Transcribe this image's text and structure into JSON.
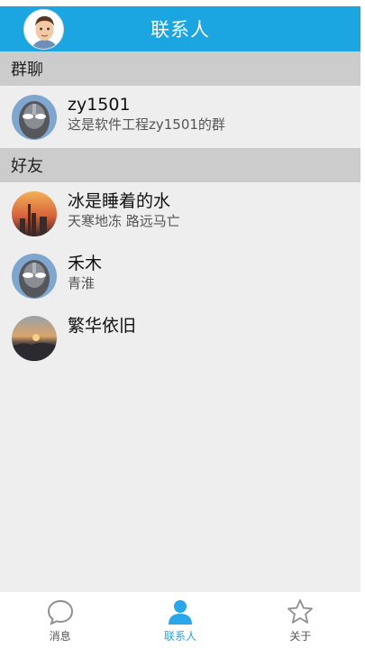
{
  "header": {
    "title": "联系人"
  },
  "groups_section": {
    "title": "群聊",
    "items": [
      {
        "name": "zy1501",
        "subtitle": "这是软件工程zy1501的群",
        "avatar": "robot-mask-avatar"
      }
    ]
  },
  "friends_section": {
    "title": "好友",
    "items": [
      {
        "name": "冰是睡着的水",
        "subtitle": "天寒地冻 路远马亡",
        "avatar": "sunset-city-avatar"
      },
      {
        "name": "禾木",
        "subtitle": "青淮",
        "avatar": "robot-mask-avatar"
      },
      {
        "name": "繁华依旧",
        "subtitle": "",
        "avatar": "misty-sunset-avatar"
      }
    ]
  },
  "bottom_nav": {
    "items": [
      {
        "label": "消息",
        "icon": "chat-bubble-icon",
        "active": false
      },
      {
        "label": "联系人",
        "icon": "person-icon",
        "active": true
      },
      {
        "label": "关于",
        "icon": "star-icon",
        "active": false
      }
    ]
  },
  "colors": {
    "accent": "#1ba5e1",
    "section_header_bg": "#cccccc",
    "list_bg": "#eeeeee"
  }
}
